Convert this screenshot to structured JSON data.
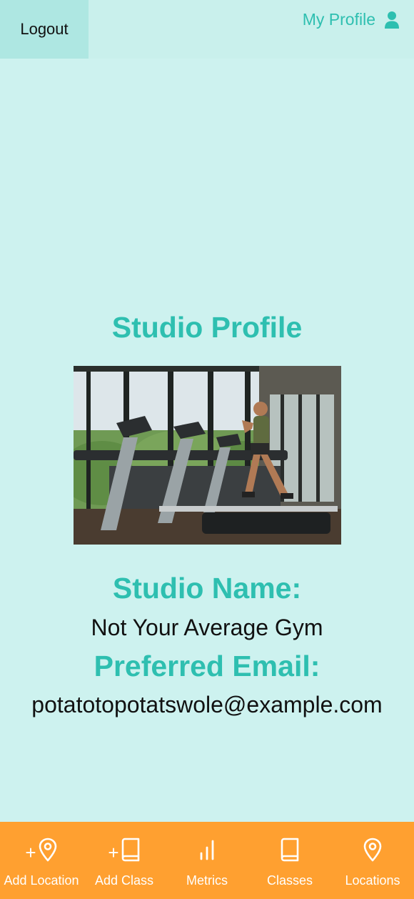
{
  "header": {
    "logout_label": "Logout",
    "profile_label": "My Profile"
  },
  "main": {
    "title": "Studio Profile",
    "name_label": "Studio Name:",
    "name_value": "Not Your Average Gym",
    "email_label": "Preferred Email:",
    "email_value": "potatotopotatswole@example.com"
  },
  "nav": {
    "items": [
      {
        "label": "Add Location",
        "icon": "plus-map-pin-icon"
      },
      {
        "label": "Add Class",
        "icon": "plus-book-icon"
      },
      {
        "label": "Metrics",
        "icon": "bar-chart-icon"
      },
      {
        "label": "Classes",
        "icon": "book-icon"
      },
      {
        "label": "Locations",
        "icon": "map-pin-icon"
      }
    ]
  },
  "colors": {
    "background": "#cdf2ef",
    "accent": "#2ebfb0",
    "logout_bg": "#aee7e2",
    "nav_bg": "#ffa030"
  }
}
